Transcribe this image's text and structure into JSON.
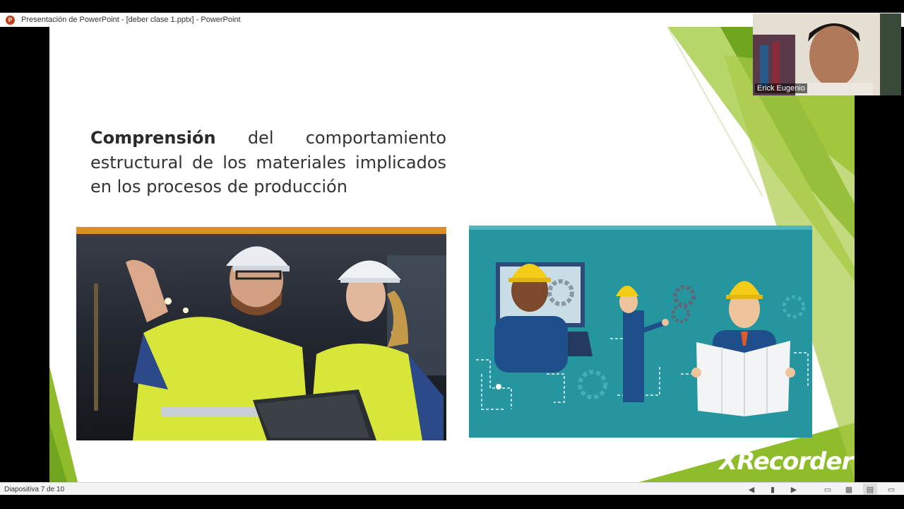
{
  "window": {
    "title": "Presentación de PowerPoint - [deber clase 1.pptx] - PowerPoint",
    "app_icon": "powerpoint-icon",
    "app_icon_letter": "P"
  },
  "slide": {
    "text_bold": "Comprensión",
    "text_rest": " del comportamiento estructural de los materiales implicados en los procesos de producción",
    "accent_colors": [
      "#8fbc2a",
      "#6fa51f",
      "#b7d66a"
    ],
    "photo": "workers-in-factory-photo",
    "illustration": "engineers-illustration"
  },
  "webcam": {
    "participant_name": "Erick Eugenio"
  },
  "watermark": {
    "text": "XRecorder"
  },
  "statusbar": {
    "slide_indicator": "Diapositiva 7 de 10",
    "icons": [
      "previous-icon",
      "slide-sorter-icon",
      "next-icon",
      "normal-view-icon",
      "grid-view-icon",
      "reading-view-icon",
      "slideshow-icon"
    ]
  }
}
